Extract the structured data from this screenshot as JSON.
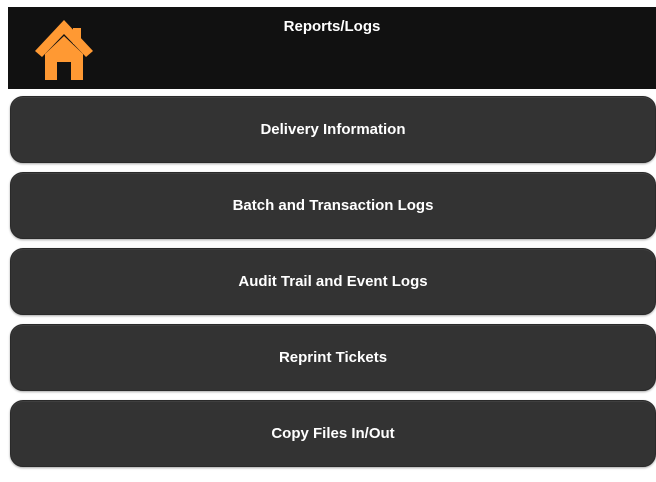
{
  "header": {
    "title": "Reports/Logs",
    "home_icon": "home-icon",
    "home_icon_color": "#FF9933",
    "background": "#111111"
  },
  "menu": {
    "items": [
      {
        "label": "Delivery Information"
      },
      {
        "label": "Batch and Transaction Logs"
      },
      {
        "label": "Audit Trail and Event Logs"
      },
      {
        "label": "Reprint Tickets"
      },
      {
        "label": "Copy Files In/Out"
      }
    ],
    "button_color": "#333333",
    "text_color": "#FFFFFF"
  }
}
